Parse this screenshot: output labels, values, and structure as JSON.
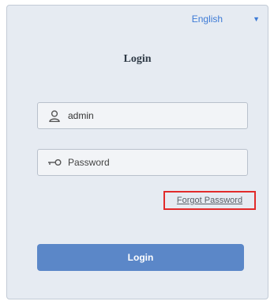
{
  "language": {
    "selected": "English",
    "caret_icon": "caret-down-icon"
  },
  "title": "Login",
  "username": {
    "icon": "user-icon",
    "value": "admin"
  },
  "password": {
    "icon": "key-icon",
    "placeholder": "Password"
  },
  "forgot_password": "Forgot Password",
  "login_button": "Login",
  "colors": {
    "panel": "#e6ebf2",
    "accent": "#3e7bd6",
    "button": "#5b87c8",
    "highlight": "#e12b2b"
  }
}
